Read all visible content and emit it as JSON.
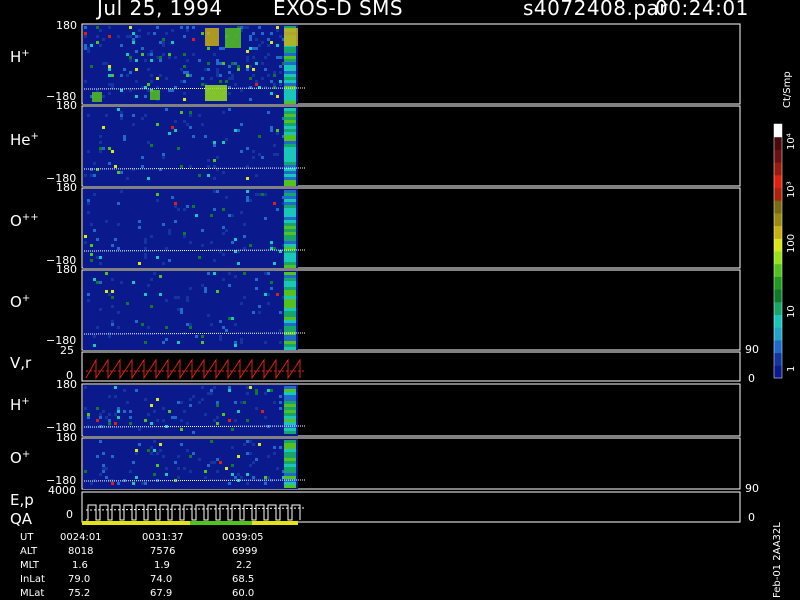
{
  "header": {
    "date": "Jul 25, 1994",
    "mission": "EXOS-D SMS",
    "file": "s4072408.par",
    "time": "00:24:01"
  },
  "panels": [
    {
      "id": "hp1",
      "label": "H",
      "sup": "+",
      "top_tick": "180",
      "bottom_tick": "−180"
    },
    {
      "id": "hep",
      "label": "He",
      "sup": "+",
      "top_tick": "180",
      "bottom_tick": "−180"
    },
    {
      "id": "opp",
      "label": "O",
      "sup": "++",
      "top_tick": "180",
      "bottom_tick": "−180"
    },
    {
      "id": "op1",
      "label": "O",
      "sup": "+",
      "top_tick": "180",
      "bottom_tick": "−180"
    },
    {
      "id": "vr",
      "label": "V,r",
      "sup": "",
      "top_tick": "25",
      "bottom_tick": "0",
      "right_top": "90",
      "right_bottom": "0"
    },
    {
      "id": "hp2",
      "label": "H",
      "sup": "+",
      "top_tick": "180",
      "bottom_tick": "−180"
    },
    {
      "id": "op2",
      "label": "O",
      "sup": "+",
      "top_tick": "180",
      "bottom_tick": "−180"
    },
    {
      "id": "ep",
      "label": "E,p",
      "sup": "",
      "top_tick": "4000",
      "bottom_tick": "0",
      "right_top": "90",
      "right_bottom": "0"
    }
  ],
  "qa_label": "QA",
  "colorbar": {
    "unit": "Ct/Smp",
    "ticks": [
      "1",
      "10",
      "100",
      "10³",
      "10⁴"
    ],
    "colors": [
      "#0a1a8c",
      "#14349e",
      "#1f6bcc",
      "#22a4c8",
      "#19c7b8",
      "#17a66a",
      "#0e7a2a",
      "#1f9b1e",
      "#54c21e",
      "#98e11c",
      "#d8e61a",
      "#c8b012",
      "#9a8a12",
      "#7a6a10",
      "#b0200c",
      "#e0200e",
      "#9a1a10",
      "#6a1010",
      "#4a0a0a",
      "#ffffff"
    ]
  },
  "footer": {
    "rows": [
      {
        "label": "UT",
        "values": [
          "0024:01",
          "0031:37",
          "0039:05"
        ]
      },
      {
        "label": "ALT",
        "values": [
          "8018",
          "7576",
          "6999"
        ]
      },
      {
        "label": "MLT",
        "values": [
          "1.6",
          "1.9",
          "2.2"
        ]
      },
      {
        "label": "InLat",
        "values": [
          "79.0",
          "74.0",
          "68.5"
        ]
      },
      {
        "label": "MLat",
        "values": [
          "75.2",
          "67.9",
          "60.0"
        ]
      }
    ],
    "stamp": "Feb-01 2AA32L"
  },
  "chart_data": {
    "type": "heatmap",
    "x": [
      "0024:01",
      "0031:37",
      "0039:05"
    ],
    "y_range": [
      -180,
      180
    ],
    "series": [
      {
        "name": "H+"
      },
      {
        "name": "He+"
      },
      {
        "name": "O++"
      },
      {
        "name": "O+"
      },
      {
        "name": "V,r"
      },
      {
        "name": "H+"
      },
      {
        "name": "O+"
      },
      {
        "name": "E,p"
      }
    ],
    "color_scale": "log",
    "color_range": [
      1,
      10000
    ]
  }
}
